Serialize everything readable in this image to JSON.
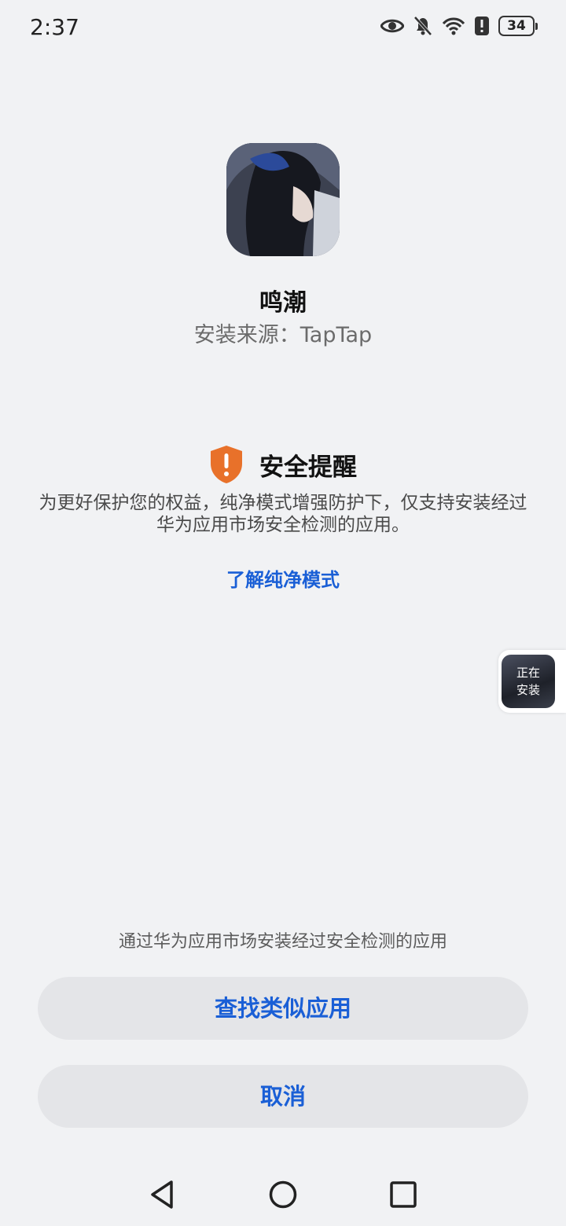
{
  "status_bar": {
    "time": "2:37",
    "battery": "34",
    "icons": [
      "eye-icon",
      "bell-off-icon",
      "wifi-icon",
      "alert-icon",
      "battery-icon"
    ]
  },
  "app": {
    "name": "鸣潮",
    "source": "安装来源：TapTap"
  },
  "security_notice": {
    "title": "安全提醒",
    "body": "为更好保护您的权益，纯净模式增强防护下，仅支持安装经过华为应用市场安全检测的应用。",
    "learn_more": "了解纯净模式"
  },
  "floating_status": {
    "line1": "正在",
    "line2": "安装"
  },
  "bottom": {
    "hint": "通过华为应用市场安装经过安全检测的应用",
    "find_similar": "查找类似应用",
    "cancel": "取消"
  },
  "nav": {
    "icons": [
      "back-icon",
      "home-icon",
      "recents-icon"
    ]
  },
  "colors": {
    "background": "#f1f2f4",
    "accent_blue": "#1a5fd6",
    "warning_orange": "#e8712a",
    "button_bg": "#e4e5e8"
  }
}
